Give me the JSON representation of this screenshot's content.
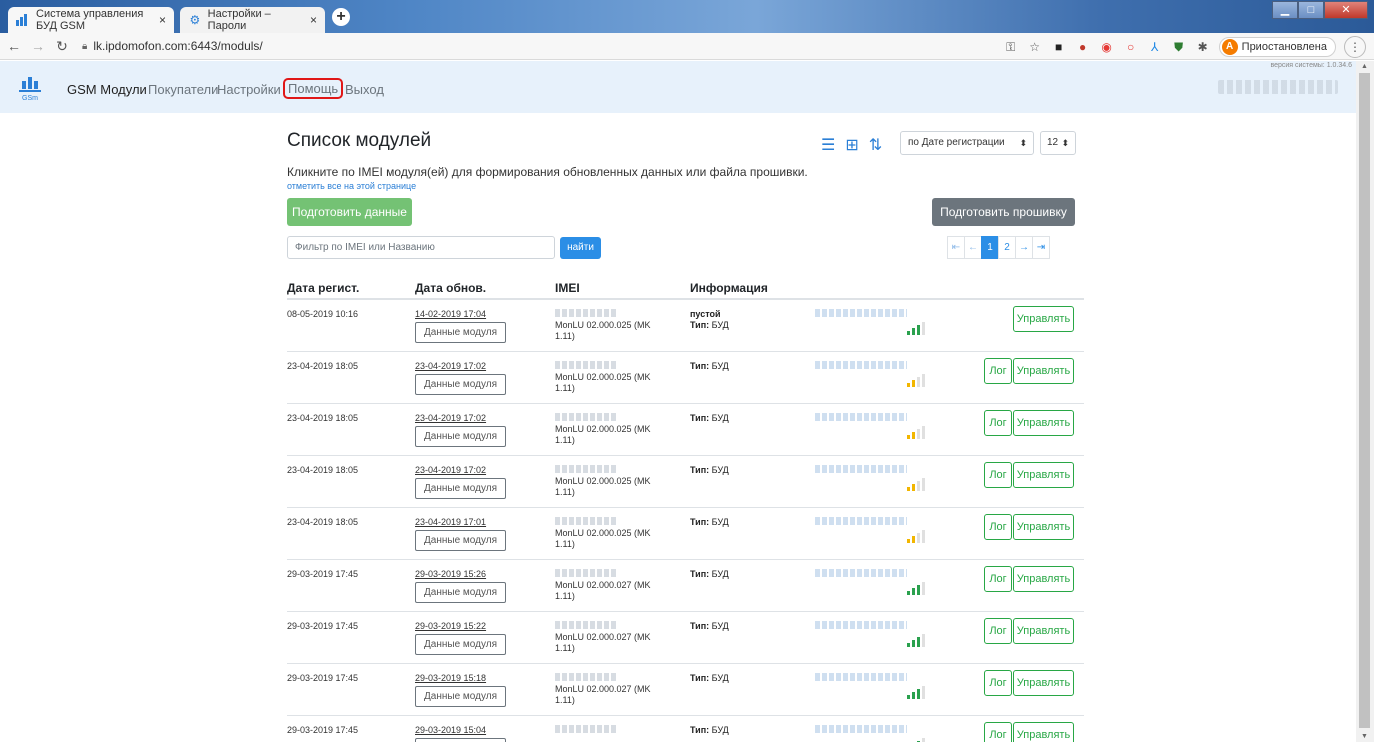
{
  "browser": {
    "tabs": [
      {
        "title": "Система управления БУД GSM",
        "close": "×"
      },
      {
        "title": "Настройки – Пароли",
        "close": "×"
      }
    ],
    "new_tab": "+",
    "url": "lk.ipdomofon.com:6443/moduls/",
    "profile_initial": "А",
    "profile_label": "Приостановлена"
  },
  "nav": {
    "brand": "GSM Модули",
    "links": [
      "Покупатели",
      "Настройки",
      "Помощь",
      "Выход"
    ],
    "version": "версия системы: 1.0.34.6"
  },
  "page": {
    "title": "Список модулей",
    "hint": "Кликните по IMEI модуля(ей) для формирования обновленных данных или файла прошивки.",
    "select_all": "отметить все на этой странице",
    "sort_select": "по Дате регистрации",
    "per_page": "12",
    "prepare_data": "Подготовить данные",
    "prepare_firmware": "Подготовить прошивку",
    "filter_placeholder": "Фильтр по IMEI или Названию",
    "find": "найти",
    "pager": {
      "first": "⇤",
      "prev": "←",
      "pages": [
        "1",
        "2"
      ],
      "next": "→",
      "last": "⇥"
    }
  },
  "colors": {
    "accent": "#2b8ee6",
    "success": "#28a745",
    "signal_good": "#2aa14e",
    "signal_mid": "#f2b600",
    "help_highlight": "#e01717"
  },
  "table": {
    "headers": [
      "Дата регист.",
      "Дата обнов.",
      "IMEI",
      "Информация"
    ],
    "module_btn": "Данные модуля",
    "log_btn": "Лог",
    "manage_btn": "Управлять",
    "type_label": "Тип:",
    "rows": [
      {
        "reg": "08-05-2019 10:16",
        "upd": "14-02-2019 17:04",
        "fw": "MonLU 02.000.025 (MK 1.11)",
        "status": "пустой",
        "type": "БУД",
        "signal": 3,
        "signal_color": "green",
        "log": false
      },
      {
        "reg": "23-04-2019 18:05",
        "upd": "23-04-2019 17:02",
        "fw": "MonLU 02.000.025 (MK 1.11)",
        "status": "",
        "type": "БУД",
        "signal": 2,
        "signal_color": "yellow",
        "log": true
      },
      {
        "reg": "23-04-2019 18:05",
        "upd": "23-04-2019 17:02",
        "fw": "MonLU 02.000.025 (MK 1.11)",
        "status": "",
        "type": "БУД",
        "signal": 2,
        "signal_color": "yellow",
        "log": true
      },
      {
        "reg": "23-04-2019 18:05",
        "upd": "23-04-2019 17:02",
        "fw": "MonLU 02.000.025 (MK 1.11)",
        "status": "",
        "type": "БУД",
        "signal": 2,
        "signal_color": "yellow",
        "log": true
      },
      {
        "reg": "23-04-2019 18:05",
        "upd": "23-04-2019 17:01",
        "fw": "MonLU 02.000.025 (MK 1.11)",
        "status": "",
        "type": "БУД",
        "signal": 2,
        "signal_color": "yellow",
        "log": true
      },
      {
        "reg": "29-03-2019 17:45",
        "upd": "29-03-2019 15:26",
        "fw": "MonLU 02.000.027 (MK 1.11)",
        "status": "",
        "type": "БУД",
        "signal": 3,
        "signal_color": "green",
        "log": true
      },
      {
        "reg": "29-03-2019 17:45",
        "upd": "29-03-2019 15:22",
        "fw": "MonLU 02.000.027 (MK 1.11)",
        "status": "",
        "type": "БУД",
        "signal": 3,
        "signal_color": "green",
        "log": true
      },
      {
        "reg": "29-03-2019 17:45",
        "upd": "29-03-2019 15:18",
        "fw": "MonLU 02.000.027 (MK 1.11)",
        "status": "",
        "type": "БУД",
        "signal": 3,
        "signal_color": "green",
        "log": true
      },
      {
        "reg": "29-03-2019 17:45",
        "upd": "29-03-2019 15:04",
        "fw": "",
        "status": "",
        "type": "БУД",
        "signal": 3,
        "signal_color": "green",
        "log": true
      }
    ]
  }
}
